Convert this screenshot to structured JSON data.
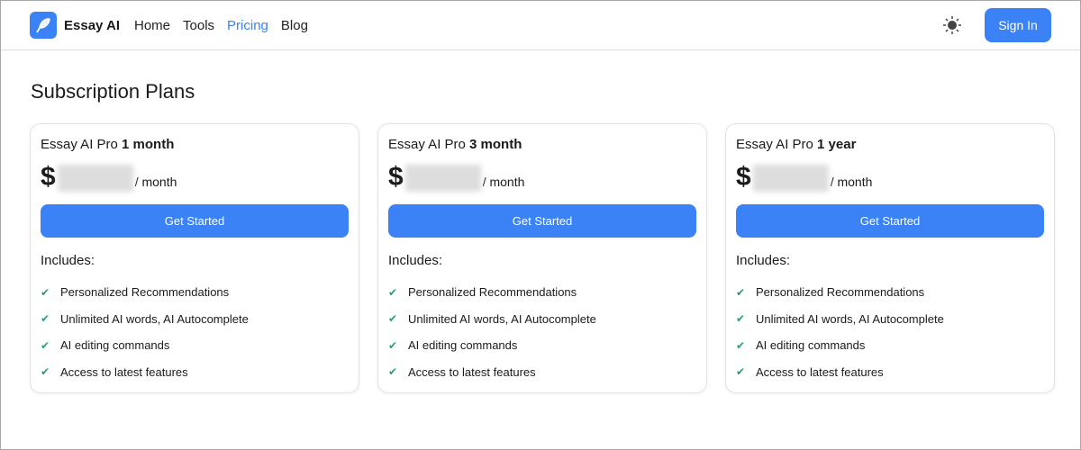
{
  "nav": {
    "brand": "Essay AI",
    "links": [
      "Home",
      "Tools",
      "Pricing",
      "Blog"
    ],
    "active": "Pricing",
    "sign_in": "Sign In"
  },
  "page": {
    "title": "Subscription Plans"
  },
  "plans": [
    {
      "prefix": "Essay AI Pro",
      "term": "1 month",
      "currency": "$",
      "per": "/ month",
      "cta": "Get Started",
      "includes_label": "Includes:",
      "features": [
        "Personalized Recommendations",
        "Unlimited AI words, AI Autocomplete",
        "AI editing commands",
        "Access to latest features"
      ]
    },
    {
      "prefix": "Essay AI Pro",
      "term": "3 month",
      "currency": "$",
      "per": "/ month",
      "cta": "Get Started",
      "includes_label": "Includes:",
      "features": [
        "Personalized Recommendations",
        "Unlimited AI words, AI Autocomplete",
        "AI editing commands",
        "Access to latest features"
      ]
    },
    {
      "prefix": "Essay AI Pro",
      "term": "1 year",
      "currency": "$",
      "per": "/ month",
      "cta": "Get Started",
      "includes_label": "Includes:",
      "features": [
        "Personalized Recommendations",
        "Unlimited AI words, AI Autocomplete",
        "AI editing commands",
        "Access to latest features"
      ]
    }
  ],
  "colors": {
    "accent": "#3b82f6",
    "check": "#22a36a"
  }
}
